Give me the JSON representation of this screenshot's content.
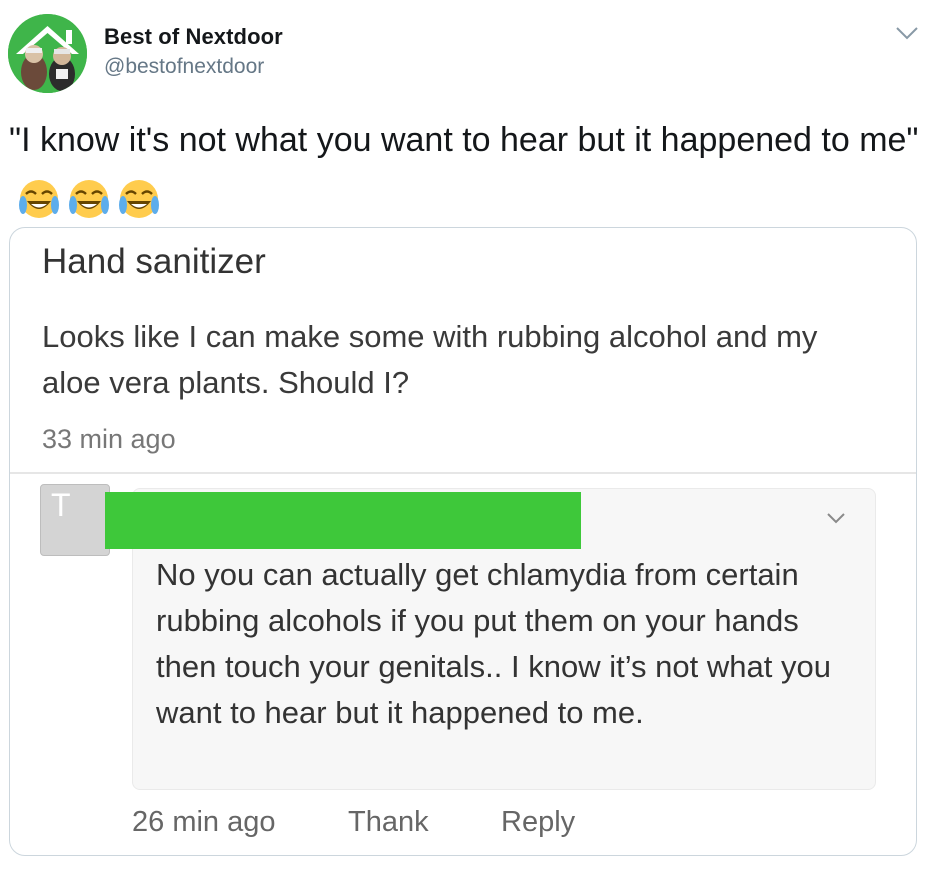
{
  "tweet": {
    "display_name": "Best of Nextdoor",
    "handle": "@bestofnextdoor",
    "text": "\"I know it's not what you want to hear but it happened to me\"",
    "emoji": [
      "face-with-tears-of-joy",
      "face-with-tears-of-joy",
      "face-with-tears-of-joy"
    ],
    "icons": {
      "avatar": "nextdoor-house-avatar",
      "menu": "chevron-down-icon"
    }
  },
  "screenshot": {
    "post": {
      "title": "Hand sanitizer",
      "body": "Looks like I can make some with rubbing alcohol and my aloe vera plants. Should I?",
      "time": "33 min ago"
    },
    "comment": {
      "avatar_letter": "T",
      "author_redaction_color": "#3ec83a",
      "text": "No you can actually get chlamydia from certain rubbing alcohols if you put them on your hands then touch your genitals.. I know it’s not what you want to hear but it happened to me.",
      "time": "26 min ago",
      "thank_label": "Thank",
      "reply_label": "Reply"
    }
  },
  "colors": {
    "avatar_green": "#3fb54a",
    "handle_gray": "#657786",
    "card_border": "#ccd6dd"
  }
}
